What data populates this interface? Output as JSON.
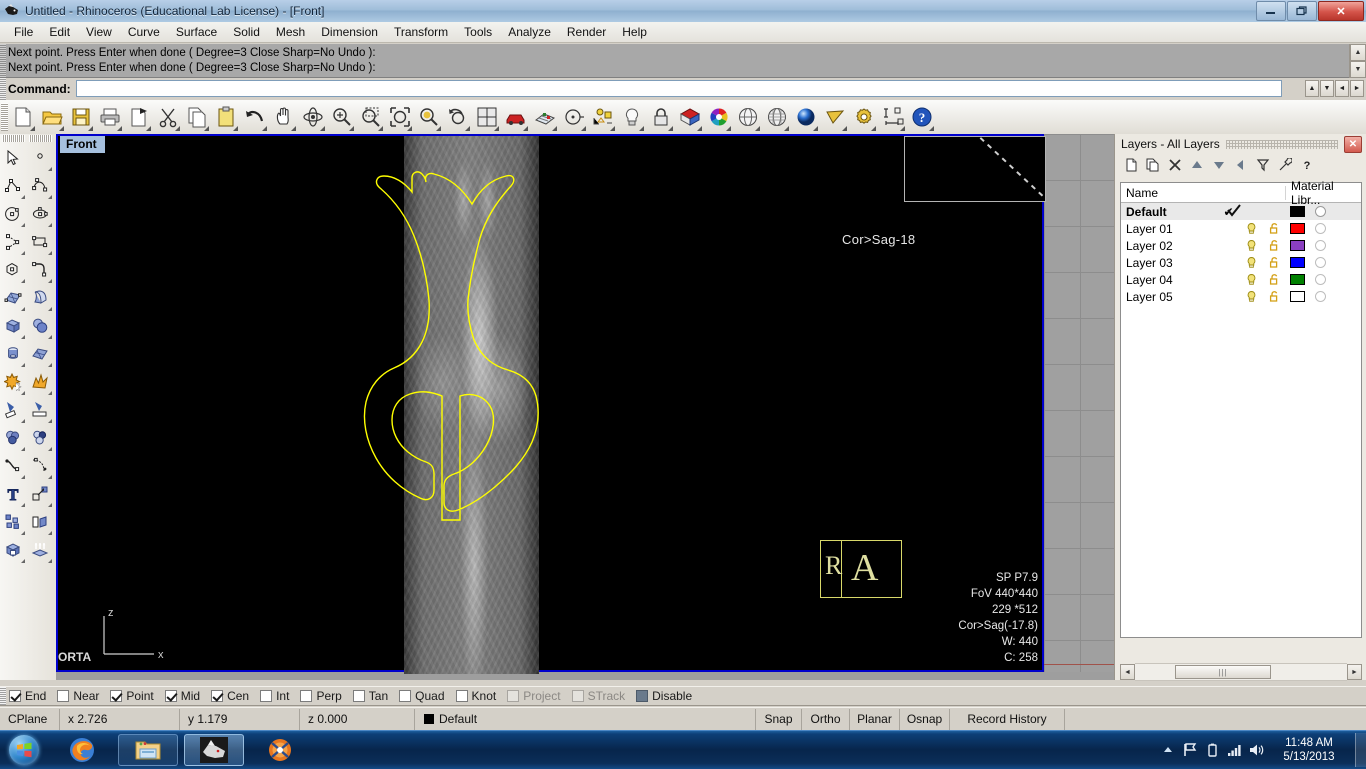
{
  "window": {
    "title": "Untitled - Rhinoceros (Educational Lab License) - [Front]",
    "icon": "rhino-icon",
    "minimize": "–",
    "restore": "❐",
    "close": "✕"
  },
  "menubar": {
    "items": [
      {
        "label": "File"
      },
      {
        "label": "Edit"
      },
      {
        "label": "View"
      },
      {
        "label": "Curve"
      },
      {
        "label": "Surface"
      },
      {
        "label": "Solid"
      },
      {
        "label": "Mesh"
      },
      {
        "label": "Dimension"
      },
      {
        "label": "Transform"
      },
      {
        "label": "Tools"
      },
      {
        "label": "Analyze"
      },
      {
        "label": "Render"
      },
      {
        "label": "Help"
      }
    ]
  },
  "command_area": {
    "history": [
      "Next point. Press Enter when done ( Degree=3  Close  Sharp=No  Undo ):",
      "Next point. Press Enter when done ( Degree=3  Close  Sharp=No  Undo ):"
    ],
    "prompt_label": "Command:",
    "input_value": "",
    "input_placeholder": ""
  },
  "main_toolbar": {
    "buttons": [
      {
        "name": "new-file-icon",
        "label": "New"
      },
      {
        "name": "open-file-icon",
        "label": "Open"
      },
      {
        "name": "save-file-icon",
        "label": "Save"
      },
      {
        "name": "print-icon",
        "label": "Print"
      },
      {
        "name": "cut-page-icon",
        "label": "Cut Page"
      },
      {
        "name": "scissors-icon",
        "label": "Cut"
      },
      {
        "name": "copy-icon",
        "label": "Copy"
      },
      {
        "name": "paste-icon",
        "label": "Paste"
      },
      {
        "name": "undo-icon",
        "label": "Undo"
      },
      {
        "name": "pan-hand-icon",
        "label": "Pan"
      },
      {
        "name": "rotate-view-icon",
        "label": "Rotate View"
      },
      {
        "name": "zoom-in-icon",
        "label": "Zoom In"
      },
      {
        "name": "zoom-window-icon",
        "label": "Zoom Window"
      },
      {
        "name": "zoom-extents-icon",
        "label": "Zoom Extents"
      },
      {
        "name": "zoom-selected-icon",
        "label": "Zoom Selected"
      },
      {
        "name": "zoom-previous-icon",
        "label": "Zoom Previous"
      },
      {
        "name": "viewport-layout-icon",
        "label": "4 Viewports"
      },
      {
        "name": "car-icon",
        "label": "Named Views"
      },
      {
        "name": "grid-plane-icon",
        "label": "CPlane"
      },
      {
        "name": "circle-point-icon",
        "label": "Point Object"
      },
      {
        "name": "object-snap-icon",
        "label": "Object Snap"
      },
      {
        "name": "light-bulb-icon",
        "label": "Light"
      },
      {
        "name": "lock-icon",
        "label": "Lock"
      },
      {
        "name": "surface-shade-icon",
        "label": "Shade"
      },
      {
        "name": "color-wheel-icon",
        "label": "Color"
      },
      {
        "name": "shaded-sphere-icon",
        "label": "Shaded View"
      },
      {
        "name": "ghosted-sphere-icon",
        "label": "Ghosted View"
      },
      {
        "name": "rendered-sphere-icon",
        "label": "Rendered View"
      },
      {
        "name": "flat-shade-icon",
        "label": "Flat Shade"
      },
      {
        "name": "gear-icon",
        "label": "Options"
      },
      {
        "name": "dimension-icon",
        "label": "Dimension"
      },
      {
        "name": "help-icon",
        "label": "Help"
      }
    ]
  },
  "left_toolbar": {
    "buttons": [
      {
        "name": "select-arrow-icon"
      },
      {
        "name": "point-icon"
      },
      {
        "name": "polyline-icon"
      },
      {
        "name": "curve-icon"
      },
      {
        "name": "circle-icon"
      },
      {
        "name": "ellipse-icon"
      },
      {
        "name": "arc-icon"
      },
      {
        "name": "rectangle-icon"
      },
      {
        "name": "polygon-icon"
      },
      {
        "name": "fillet-curve-icon"
      },
      {
        "name": "surface-from-points-icon"
      },
      {
        "name": "extrude-surface-icon"
      },
      {
        "name": "box-icon"
      },
      {
        "name": "sphere-icon"
      },
      {
        "name": "cylinder-icon"
      },
      {
        "name": "surface-grid-icon"
      },
      {
        "name": "boolean-union-icon"
      },
      {
        "name": "explode-icon"
      },
      {
        "name": "trim-icon"
      },
      {
        "name": "split-icon"
      },
      {
        "name": "boolean-difference-icon"
      },
      {
        "name": "boolean-intersection-icon"
      },
      {
        "name": "blend-curve-icon"
      },
      {
        "name": "fillet-edge-icon"
      },
      {
        "name": "text-icon"
      },
      {
        "name": "scale-icon"
      },
      {
        "name": "group-icon"
      },
      {
        "name": "copy-object-icon"
      },
      {
        "name": "cap-solid-icon"
      },
      {
        "name": "extrude-up-icon"
      }
    ]
  },
  "viewport": {
    "tab_label": "Front",
    "axis_labels": {
      "vertical": "z",
      "horizontal": "x"
    },
    "corner_text": "ORTA",
    "slice_label": "Cor>Sag-18",
    "orientation_marker": {
      "left": "R",
      "right": "A"
    },
    "dicom_info": [
      "SP P7.9",
      "FoV 440*440",
      "229 *512",
      "Cor>Sag(-17.8)",
      "W: 440",
      "C: 258"
    ],
    "curve_color": "#ffff00",
    "active_border_color": "#0000cd"
  },
  "layers_panel": {
    "title": "Layers - All Layers",
    "close_label": "✕",
    "tools": [
      {
        "name": "new-layer-icon",
        "label": "New Layer"
      },
      {
        "name": "copy-layer-icon",
        "label": "Copy Layer"
      },
      {
        "name": "delete-layer-icon",
        "label": "Delete Layer"
      },
      {
        "name": "move-up-icon",
        "label": "Move Up"
      },
      {
        "name": "move-down-icon",
        "label": "Move Down"
      },
      {
        "name": "previous-icon",
        "label": "Previous"
      },
      {
        "name": "filter-icon",
        "label": "Filter"
      },
      {
        "name": "properties-icon",
        "label": "Properties"
      },
      {
        "name": "help-icon",
        "label": "Help"
      }
    ],
    "columns": [
      "Name",
      "Material Libr..."
    ],
    "rows": [
      {
        "name": "Default",
        "current": "✔",
        "bulb": "",
        "lock": "",
        "color": "#000000",
        "selected": true
      },
      {
        "name": "Layer 01",
        "current": "",
        "bulb": "bulb-icon",
        "lock": "unlock-icon",
        "color": "#ff0000",
        "selected": false
      },
      {
        "name": "Layer 02",
        "current": "",
        "bulb": "bulb-icon",
        "lock": "unlock-icon",
        "color": "#8a3fc0",
        "selected": false
      },
      {
        "name": "Layer 03",
        "current": "",
        "bulb": "bulb-icon",
        "lock": "unlock-icon",
        "color": "#0000ff",
        "selected": false
      },
      {
        "name": "Layer 04",
        "current": "",
        "bulb": "bulb-icon",
        "lock": "unlock-icon",
        "color": "#008000",
        "selected": false
      },
      {
        "name": "Layer 05",
        "current": "",
        "bulb": "bulb-icon",
        "lock": "unlock-icon",
        "color": "#ffffff",
        "selected": false
      }
    ],
    "scroll_thumb": "|||"
  },
  "osnap_bar": {
    "items": [
      {
        "label": "End",
        "checked": true,
        "disabled": false
      },
      {
        "label": "Near",
        "checked": false,
        "disabled": false
      },
      {
        "label": "Point",
        "checked": true,
        "disabled": false
      },
      {
        "label": "Mid",
        "checked": true,
        "disabled": false
      },
      {
        "label": "Cen",
        "checked": true,
        "disabled": false
      },
      {
        "label": "Int",
        "checked": false,
        "disabled": false
      },
      {
        "label": "Perp",
        "checked": false,
        "disabled": false
      },
      {
        "label": "Tan",
        "checked": false,
        "disabled": false
      },
      {
        "label": "Quad",
        "checked": false,
        "disabled": false
      },
      {
        "label": "Knot",
        "checked": false,
        "disabled": false
      },
      {
        "label": "Project",
        "checked": false,
        "disabled": true
      },
      {
        "label": "STrack",
        "checked": false,
        "disabled": true
      },
      {
        "label": "Disable",
        "checked": false,
        "disabled": false,
        "dark": true
      }
    ]
  },
  "status_bar": {
    "cplane": "CPlane",
    "x": "x 2.726",
    "y": "y 1.179",
    "z": "z 0.000",
    "layer": "Default",
    "toggles": [
      "Snap",
      "Ortho",
      "Planar",
      "Osnap",
      "Record History"
    ]
  },
  "taskbar": {
    "start": "start-orb-icon",
    "apps": [
      {
        "name": "firefox-icon",
        "active": false,
        "pinned": false
      },
      {
        "name": "file-explorer-icon",
        "active": false,
        "pinned": true
      },
      {
        "name": "rhinoceros-icon",
        "active": true,
        "pinned": true
      },
      {
        "name": "media-player-icon",
        "active": false,
        "pinned": false
      }
    ],
    "tray": [
      {
        "name": "show-hidden-icons-icon"
      },
      {
        "name": "network-flag-icon"
      },
      {
        "name": "battery-icon"
      },
      {
        "name": "signal-bars-icon"
      },
      {
        "name": "volume-icon"
      }
    ],
    "clock_time": "11:48 AM",
    "clock_date": "5/13/2013"
  }
}
